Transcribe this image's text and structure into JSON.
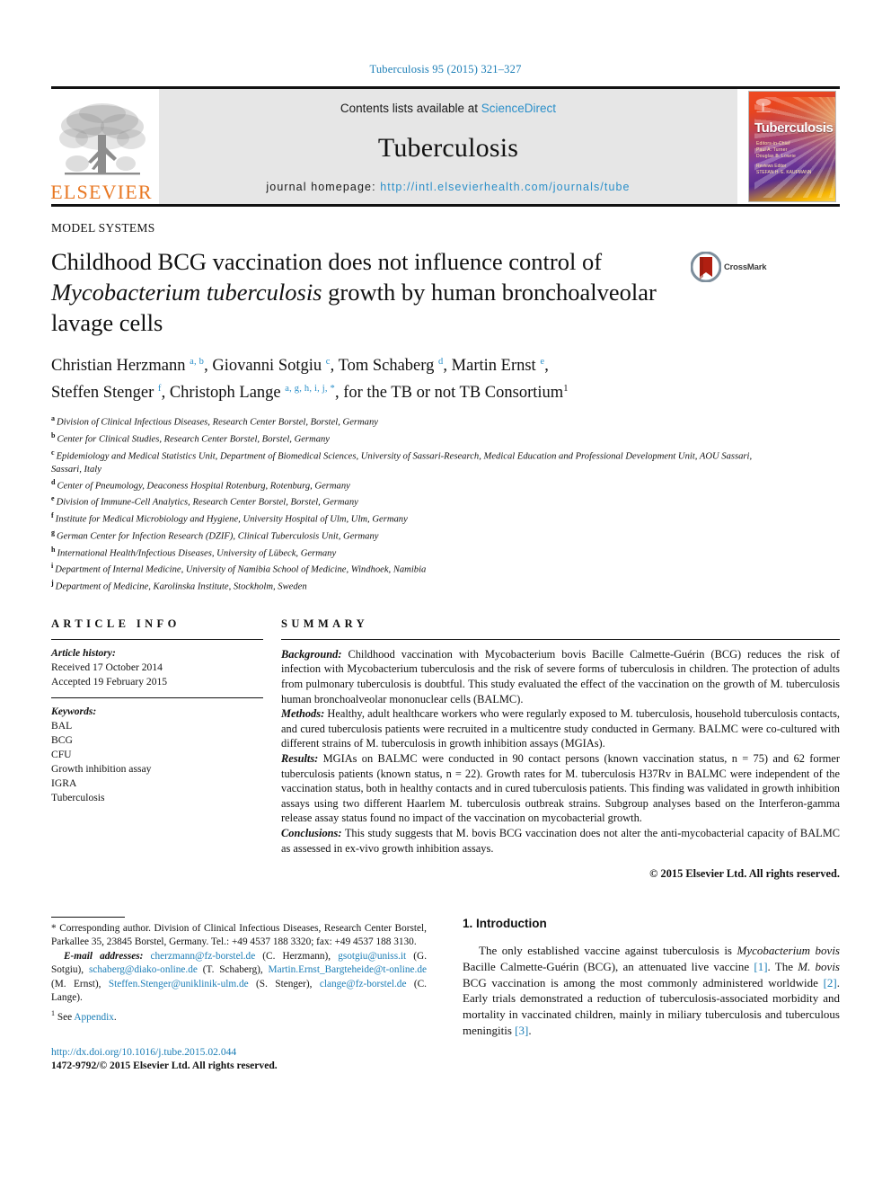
{
  "running_head": "Tuberculosis 95 (2015) 321–327",
  "masthead": {
    "publisher_logo_label": "ELSEVIER",
    "contents_prefix": "Contents lists available at",
    "contents_link": "ScienceDirect",
    "journal_name": "Tuberculosis",
    "homepage_prefix": "journal homepage:",
    "homepage_url": "http://intl.elsevierhealth.com/journals/tube",
    "cover": {
      "title": "Tuberculosis",
      "sub_line1": "Editors-in-Chief",
      "sub_line2": "Paul A. Turner",
      "sub_line3": "Douglas B. Lowrie",
      "sub_line4": "Reviews Editor",
      "sub_line5": "STEFAN H. E. KAUFMANN"
    }
  },
  "section_label": "MODEL SYSTEMS",
  "title": {
    "line1": "Childhood BCG vaccination does not influence control of",
    "line2_italic": "Mycobacterium tuberculosis",
    "line2_rest": " growth by human bronchoalveolar",
    "line3": "lavage cells"
  },
  "crossmark": {
    "label": "CrossMark"
  },
  "authors": {
    "list": [
      {
        "name": "Christian Herzmann",
        "marks": "a, b"
      },
      {
        "name": "Giovanni Sotgiu",
        "marks": "c"
      },
      {
        "name": "Tom Schaberg",
        "marks": "d"
      },
      {
        "name": "Martin Ernst",
        "marks": "e"
      },
      {
        "name": "Steffen Stenger",
        "marks": "f"
      },
      {
        "name": "Christoph Lange",
        "marks": "a, g, h, i, j, *"
      }
    ],
    "consortium": "for the TB or not TB Consortium",
    "consortium_mark": "1"
  },
  "affiliations": [
    {
      "mark": "a",
      "text": "Division of Clinical Infectious Diseases, Research Center Borstel, Borstel, Germany"
    },
    {
      "mark": "b",
      "text": "Center for Clinical Studies, Research Center Borstel, Borstel, Germany"
    },
    {
      "mark": "c",
      "text": "Epidemiology and Medical Statistics Unit, Department of Biomedical Sciences, University of Sassari-Research, Medical Education and Professional Development Unit, AOU Sassari, Sassari, Italy"
    },
    {
      "mark": "d",
      "text": "Center of Pneumology, Deaconess Hospital Rotenburg, Rotenburg, Germany"
    },
    {
      "mark": "e",
      "text": "Division of Immune-Cell Analytics, Research Center Borstel, Borstel, Germany"
    },
    {
      "mark": "f",
      "text": "Institute for Medical Microbiology and Hygiene, University Hospital of Ulm, Ulm, Germany"
    },
    {
      "mark": "g",
      "text": "German Center for Infection Research (DZIF), Clinical Tuberculosis Unit, Germany"
    },
    {
      "mark": "h",
      "text": "International Health/Infectious Diseases, University of Lübeck, Germany"
    },
    {
      "mark": "i",
      "text": "Department of Internal Medicine, University of Namibia School of Medicine, Windhoek, Namibia"
    },
    {
      "mark": "j",
      "text": "Department of Medicine, Karolinska Institute, Stockholm, Sweden"
    }
  ],
  "article_info": {
    "heading": "ARTICLE INFO",
    "history_label": "Article history:",
    "received": "Received 17 October 2014",
    "accepted": "Accepted 19 February 2015",
    "keywords_label": "Keywords:",
    "keywords": [
      "BAL",
      "BCG",
      "CFU",
      "Growth inhibition assay",
      "IGRA",
      "Tuberculosis"
    ]
  },
  "summary": {
    "heading": "SUMMARY",
    "background_label": "Background:",
    "background": " Childhood vaccination with Mycobacterium bovis Bacille Calmette-Guérin (BCG) reduces the risk of infection with Mycobacterium tuberculosis and the risk of severe forms of tuberculosis in children. The protection of adults from pulmonary tuberculosis is doubtful. This study evaluated the effect of the vaccination on the growth of M. tuberculosis human bronchoalveolar mononuclear cells (BALMC).",
    "methods_label": "Methods:",
    "methods": " Healthy, adult healthcare workers who were regularly exposed to M. tuberculosis, household tuberculosis contacts, and cured tuberculosis patients were recruited in a multicentre study conducted in Germany. BALMC were co-cultured with different strains of M. tuberculosis in growth inhibition assays (MGIAs).",
    "results_label": "Results:",
    "results": " MGIAs on BALMC were conducted in 90 contact persons (known vaccination status, n = 75) and 62 former tuberculosis patients (known status, n = 22). Growth rates for M. tuberculosis H37Rv in BALMC were independent of the vaccination status, both in healthy contacts and in cured tuberculosis patients. This finding was validated in growth inhibition assays using two different Haarlem M. tuberculosis outbreak strains. Subgroup analyses based on the Interferon-gamma release assay status found no impact of the vaccination on mycobacterial growth.",
    "conclusions_label": "Conclusions:",
    "conclusions": " This study suggests that M. bovis BCG vaccination does not alter the anti-mycobacterial capacity of BALMC as assessed in ex-vivo growth inhibition assays.",
    "copyright": "© 2015 Elsevier Ltd. All rights reserved."
  },
  "footnotes": {
    "corresponding": "* Corresponding author. Division of Clinical Infectious Diseases, Research Center Borstel, Parkallee 35, 23845 Borstel, Germany. Tel.: +49 4537 188 3320; fax: +49 4537 188 3130.",
    "email_label": "E-mail addresses:",
    "emails": [
      {
        "address": "cherzmann@fz-borstel.de",
        "person": "(C. Herzmann)"
      },
      {
        "address": "gsotgiu@uniss.it",
        "person": "(G. Sotgiu)"
      },
      {
        "address": "schaberg@diako-online.de",
        "person": "(T. Schaberg)"
      },
      {
        "address": "Martin.Ernst_Bargteheide@t-online.de",
        "person": "(M. Ernst)"
      },
      {
        "address": "Steffen.Stenger@uniklinik-ulm.de",
        "person": "(S. Stenger)"
      },
      {
        "address": "clange@fz-borstel.de",
        "person": "(C. Lange)"
      }
    ],
    "appendix_mark": "1",
    "appendix_text": "See ",
    "appendix_link": "Appendix",
    "appendix_end": ".",
    "doi": "http://dx.doi.org/10.1016/j.tube.2015.02.044",
    "issn": "1472-9792/© 2015 Elsevier Ltd. All rights reserved."
  },
  "introduction": {
    "heading": "1. Introduction",
    "paragraph_part1": "The only established vaccine against tuberculosis is ",
    "paragraph_italic1": "Mycobacterium bovis",
    "paragraph_part2": " Bacille Calmette-Guérin (BCG), an attenuated live vaccine ",
    "ref1": "[1]",
    "paragraph_part3": ". The ",
    "paragraph_italic2": "M. bovis",
    "paragraph_part4": " BCG vaccination is among the most commonly administered worldwide ",
    "ref2": "[2]",
    "paragraph_part5": ". Early trials demonstrated a reduction of tuberculosis-associated morbidity and mortality in vaccinated children, mainly in miliary tuberculosis and tuberculous meningitis ",
    "ref3": "[3]",
    "paragraph_part6": "."
  },
  "colors": {
    "link_blue": "#1a7db6",
    "sciencedirect_blue": "#2b8fc9",
    "elsevier_orange": "#e87722",
    "band_gray": "#e6e6e6"
  }
}
